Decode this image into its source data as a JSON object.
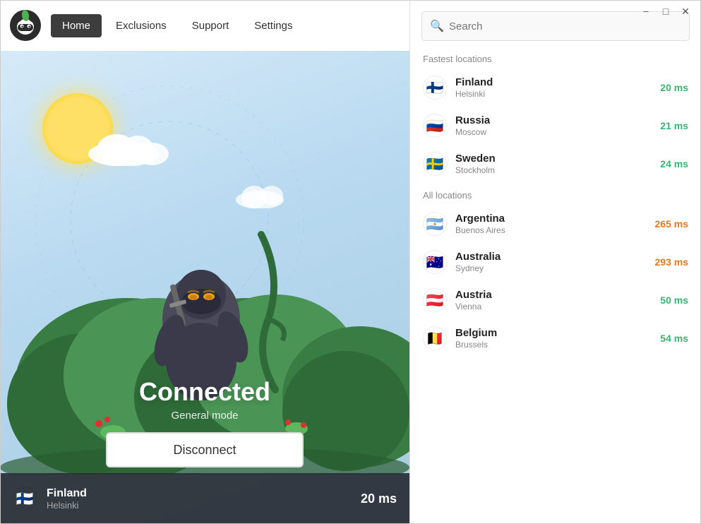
{
  "titlebar": {
    "minimize_label": "−",
    "maximize_label": "□",
    "close_label": "✕"
  },
  "navbar": {
    "logo_alt": "TunnelBear Logo",
    "items": [
      {
        "label": "Home",
        "active": true
      },
      {
        "label": "Exclusions",
        "active": false
      },
      {
        "label": "Support",
        "active": false
      },
      {
        "label": "Settings",
        "active": false
      }
    ]
  },
  "left_panel": {
    "status": "Connected",
    "mode": "General mode",
    "disconnect_label": "Disconnect",
    "bottom_bar": {
      "country": "Finland",
      "city": "Helsinki",
      "ms": "20 ms"
    }
  },
  "right_panel": {
    "search_placeholder": "Search",
    "fastest_label": "Fastest locations",
    "all_label": "All locations",
    "fastest": [
      {
        "country": "Finland",
        "city": "Helsinki",
        "ms": "20 ms",
        "ms_class": "ms-green",
        "flag": "🇫🇮"
      },
      {
        "country": "Russia",
        "city": "Moscow",
        "ms": "21 ms",
        "ms_class": "ms-green",
        "flag": "🇷🇺"
      },
      {
        "country": "Sweden",
        "city": "Stockholm",
        "ms": "24 ms",
        "ms_class": "ms-green",
        "flag": "🇸🇪"
      }
    ],
    "all": [
      {
        "country": "Argentina",
        "city": "Buenos Aires",
        "ms": "265 ms",
        "ms_class": "ms-orange",
        "flag": "🇦🇷"
      },
      {
        "country": "Australia",
        "city": "Sydney",
        "ms": "293 ms",
        "ms_class": "ms-orange",
        "flag": "🇦🇺"
      },
      {
        "country": "Austria",
        "city": "Vienna",
        "ms": "50 ms",
        "ms_class": "ms-green",
        "flag": "🇦🇹"
      },
      {
        "country": "Belgium",
        "city": "Brussels",
        "ms": "54 ms",
        "ms_class": "ms-green",
        "flag": "🇧🇪"
      }
    ]
  }
}
